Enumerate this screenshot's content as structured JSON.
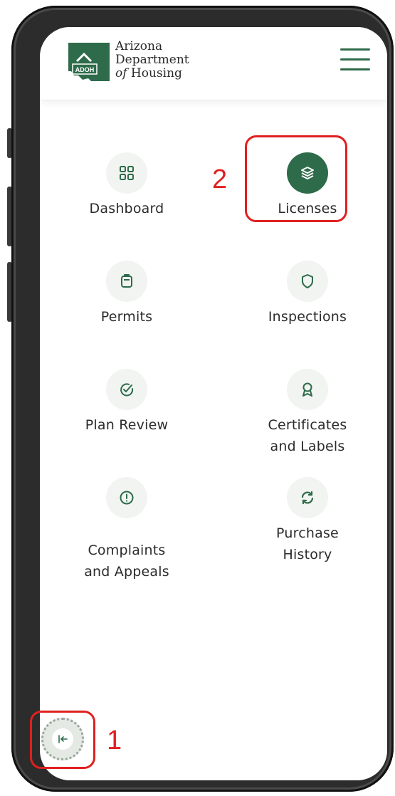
{
  "header": {
    "logo_badge": "ADOH",
    "logo_line1": "Arizona",
    "logo_line2": "Department",
    "logo_line3_prefix": "of",
    "logo_line3_rest": " Housing",
    "menu_icon": "hamburger-menu-icon"
  },
  "nav": {
    "dashboard": {
      "label": "Dashboard",
      "icon": "grid-icon"
    },
    "licenses": {
      "label": "Licenses",
      "icon": "layers-icon",
      "active": true
    },
    "permits": {
      "label": "Permits",
      "icon": "clipboard-icon"
    },
    "inspections": {
      "label": "Inspections",
      "icon": "shield-icon"
    },
    "plan_review": {
      "label": "Plan Review",
      "icon": "check-circle-icon"
    },
    "certificates": {
      "label": "Certificates\nand Labels",
      "icon": "award-ribbon-icon"
    },
    "complaints": {
      "label": "Complaints\nand Appeals",
      "icon": "alert-circle-icon"
    },
    "purchase_history": {
      "label": "Purchase\nHistory",
      "icon": "refresh-icon"
    }
  },
  "annotations": {
    "step1": "1",
    "step2": "2"
  },
  "collapse_button": {
    "icon": "collapse-left-icon"
  },
  "colors": {
    "accent": "#2e6b4a",
    "annotation": "#e02020",
    "icon_bg": "#f1f4f1"
  }
}
